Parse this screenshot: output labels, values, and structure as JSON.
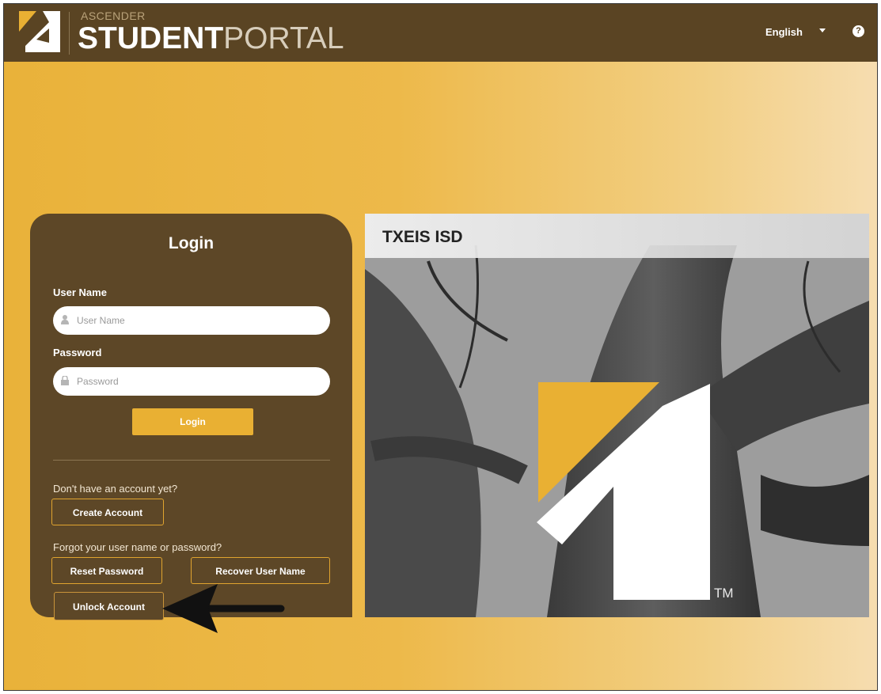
{
  "header": {
    "brand_top": "ASCENDER",
    "brand_main_bold": "STUDENT",
    "brand_main_light": "PORTAL",
    "language": "English",
    "help_symbol": "?"
  },
  "login": {
    "title": "Login",
    "username_label": "User Name",
    "username_placeholder": "User Name",
    "password_label": "Password",
    "password_placeholder": "Password",
    "login_button": "Login",
    "no_account_text": "Don't have an account yet?",
    "create_account_button": "Create Account",
    "forgot_text": "Forgot your user name or password?",
    "reset_password_button": "Reset Password",
    "recover_username_button": "Recover User Name",
    "unlock_account_button": "Unlock Account"
  },
  "card": {
    "district_name": "TXEIS ISD",
    "trademark": "TM"
  },
  "colors": {
    "header_bg": "#5a4423",
    "panel_bg": "#5d4727",
    "accent_gold": "#e9b033",
    "background_gold": "#edb94a"
  },
  "icons": [
    "ascender-logo-icon",
    "chevron-down-icon",
    "help-icon",
    "user-icon",
    "lock-icon",
    "arrow-left-icon"
  ]
}
